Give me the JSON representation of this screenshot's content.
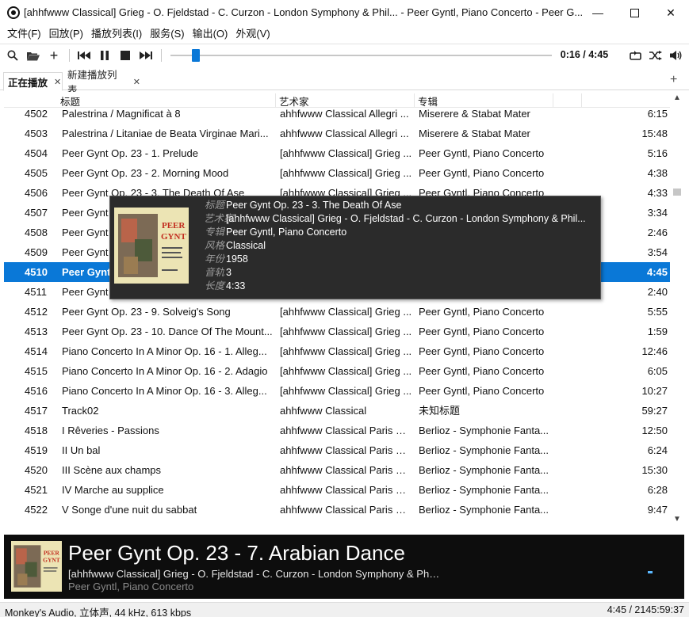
{
  "window": {
    "title": "[ahhfwww Classical] Grieg - O. Fjeldstad - C. Curzon - London Symphony & Phil... - Peer Gyntl, Piano Concerto - Peer G...",
    "minimize": "—",
    "close": "✕"
  },
  "menu": [
    "文件(F)",
    "回放(P)",
    "播放列表(I)",
    "服务(S)",
    "输出(O)",
    "外观(V)"
  ],
  "toolbar": {
    "time": "0:16 / 4:45",
    "seek_fraction": 0.058
  },
  "tabs": {
    "active": "正在播放",
    "inactive": "新建播放列表",
    "close": "✕",
    "add": "+"
  },
  "columns": {
    "title": "标题",
    "artist": "艺术家",
    "album": "专辑"
  },
  "rows": [
    {
      "num": "4502",
      "title": "Palestrina / Magnificat à 8",
      "artist": "ahhfwww Classical Allegri ...",
      "album": "Miserere & Stabat Mater",
      "dur": "6:15"
    },
    {
      "num": "4503",
      "title": "Palestrina / Litaniae de Beata Virginae Mari...",
      "artist": "ahhfwww Classical Allegri ...",
      "album": "Miserere & Stabat Mater",
      "dur": "15:48"
    },
    {
      "num": "4504",
      "title": "Peer Gynt Op. 23 - 1. Prelude",
      "artist": "[ahhfwww Classical] Grieg ...",
      "album": "Peer Gyntl, Piano Concerto",
      "dur": "5:16"
    },
    {
      "num": "4505",
      "title": "Peer Gynt Op. 23 - 2. Morning Mood",
      "artist": "[ahhfwww Classical] Grieg ...",
      "album": "Peer Gyntl, Piano Concerto",
      "dur": "4:38"
    },
    {
      "num": "4506",
      "title": "Peer Gynt Op. 23 - 3. The Death Of Ase",
      "artist": "[ahhfwww Classical] Grieg ...",
      "album": "Peer Gyntl, Piano Concerto",
      "dur": "4:33"
    },
    {
      "num": "4507",
      "title": "Peer Gynt",
      "artist": "",
      "album": "",
      "dur": "3:34"
    },
    {
      "num": "4508",
      "title": "Peer Gynt",
      "artist": "",
      "album": "",
      "dur": "2:46"
    },
    {
      "num": "4509",
      "title": "Peer Gynt",
      "artist": "",
      "album": "",
      "dur": "3:54"
    },
    {
      "num": "4510",
      "title": "Peer Gynt",
      "artist": "",
      "album": "",
      "dur": "4:45",
      "selected": true
    },
    {
      "num": "4511",
      "title": "Peer Gynt",
      "artist": "",
      "album": "",
      "dur": "2:40"
    },
    {
      "num": "4512",
      "title": "Peer Gynt Op. 23 - 9. Solveig's Song",
      "artist": "[ahhfwww Classical] Grieg ...",
      "album": "Peer Gyntl, Piano Concerto",
      "dur": "5:55"
    },
    {
      "num": "4513",
      "title": "Peer Gynt Op. 23 - 10. Dance Of The Mount...",
      "artist": "[ahhfwww Classical] Grieg ...",
      "album": "Peer Gyntl, Piano Concerto",
      "dur": "1:59"
    },
    {
      "num": "4514",
      "title": "Piano Concerto In A Minor Op. 16 - 1. Alleg...",
      "artist": "[ahhfwww Classical] Grieg ...",
      "album": "Peer Gyntl, Piano Concerto",
      "dur": "12:46"
    },
    {
      "num": "4515",
      "title": "Piano Concerto In A Minor Op. 16 - 2. Adagio",
      "artist": "[ahhfwww Classical] Grieg ...",
      "album": "Peer Gyntl, Piano Concerto",
      "dur": "6:05"
    },
    {
      "num": "4516",
      "title": "Piano Concerto In A Minor Op. 16 - 3. Alleg...",
      "artist": "[ahhfwww Classical] Grieg ...",
      "album": "Peer Gyntl, Piano Concerto",
      "dur": "10:27"
    },
    {
      "num": "4517",
      "title": "Track02",
      "artist": "ahhfwww Classical",
      "album": "未知标题",
      "dur": "59:27"
    },
    {
      "num": "4518",
      "title": "I Rêveries - Passions",
      "artist": "ahhfwww Classical Paris Co...",
      "album": "Berlioz - Symphonie Fanta...",
      "dur": "12:50"
    },
    {
      "num": "4519",
      "title": "II Un bal",
      "artist": "ahhfwww Classical Paris Co...",
      "album": "Berlioz - Symphonie Fanta...",
      "dur": "6:24"
    },
    {
      "num": "4520",
      "title": "III Scène aux champs",
      "artist": "ahhfwww Classical Paris Co...",
      "album": "Berlioz - Symphonie Fanta...",
      "dur": "15:30"
    },
    {
      "num": "4521",
      "title": "IV Marche au supplice",
      "artist": "ahhfwww Classical Paris Co...",
      "album": "Berlioz - Symphonie Fanta...",
      "dur": "6:28"
    },
    {
      "num": "4522",
      "title": "V Songe d'une nuit du sabbat",
      "artist": "ahhfwww Classical Paris Co...",
      "album": "Berlioz - Symphonie Fanta...",
      "dur": "9:47"
    }
  ],
  "tooltip": {
    "lines": [
      {
        "key": "标题",
        "value": "Peer Gynt Op. 23 - 3. The Death Of Ase"
      },
      {
        "key": "艺术家",
        "value": "[ahhfwww Classical] Grieg - O. Fjeldstad - C. Curzon - London Symphony & Phil..."
      },
      {
        "key": "专辑",
        "value": "Peer Gyntl, Piano Concerto"
      },
      {
        "key": "风格",
        "value": "Classical"
      },
      {
        "key": "年份",
        "value": "1958"
      },
      {
        "key": "音轨",
        "value": "3"
      },
      {
        "key": "长度",
        "value": "4:33"
      }
    ],
    "cover_lettering": [
      "PEER",
      "GYNT"
    ]
  },
  "now_playing": {
    "title": "Peer Gynt Op. 23 - 7. Arabian Dance",
    "artist": "[ahhfwww Classical] Grieg - O. Fjeldstad - C. Curzon - London Symphony & Phil...",
    "album": "Peer Gyntl, Piano Concerto"
  },
  "status": {
    "left": "Monkey's Audio, 立体声, 44 kHz, 613 kbps",
    "right": "4:45 / 2145:59:37"
  },
  "colors": {
    "selection": "#0a78d7",
    "now_playing_bg": "#0d0d0d",
    "tooltip_bg": "#2b2b2b"
  },
  "icons": [
    "search-icon",
    "folder-open-icon",
    "add-icon",
    "previous-icon",
    "pause-icon",
    "stop-icon",
    "next-icon",
    "repeat-icon",
    "shuffle-icon",
    "volume-icon"
  ]
}
